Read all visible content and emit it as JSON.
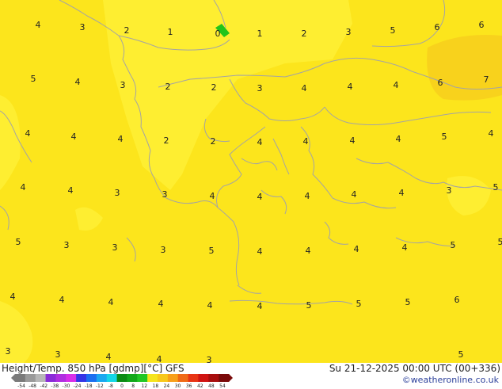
{
  "map": {
    "temperature_labels": [
      {
        "text": "4"
      },
      {
        "text": "3"
      },
      {
        "text": "2"
      },
      {
        "text": "1"
      },
      {
        "text": "0"
      },
      {
        "text": "1"
      },
      {
        "text": "2"
      },
      {
        "text": "3"
      },
      {
        "text": "5"
      },
      {
        "text": "6"
      },
      {
        "text": "6"
      },
      {
        "text": "5"
      },
      {
        "text": "4"
      },
      {
        "text": "3"
      },
      {
        "text": "2"
      },
      {
        "text": "2"
      },
      {
        "text": "3"
      },
      {
        "text": "4"
      },
      {
        "text": "4"
      },
      {
        "text": "4"
      },
      {
        "text": "6"
      },
      {
        "text": "7"
      },
      {
        "text": "4"
      },
      {
        "text": "4"
      },
      {
        "text": "4"
      },
      {
        "text": "2"
      },
      {
        "text": "2"
      },
      {
        "text": "4"
      },
      {
        "text": "4"
      },
      {
        "text": "4"
      },
      {
        "text": "4"
      },
      {
        "text": "5"
      },
      {
        "text": "4"
      },
      {
        "text": "4"
      },
      {
        "text": "4"
      },
      {
        "text": "3"
      },
      {
        "text": "3"
      },
      {
        "text": "4"
      },
      {
        "text": "4"
      },
      {
        "text": "4"
      },
      {
        "text": "4"
      },
      {
        "text": "4"
      },
      {
        "text": "3"
      },
      {
        "text": "5"
      },
      {
        "text": "5"
      },
      {
        "text": "3"
      },
      {
        "text": "3"
      },
      {
        "text": "3"
      },
      {
        "text": "5"
      },
      {
        "text": "4"
      },
      {
        "text": "4"
      },
      {
        "text": "4"
      },
      {
        "text": "4"
      },
      {
        "text": "5"
      },
      {
        "text": "5"
      },
      {
        "text": "4"
      },
      {
        "text": "4"
      },
      {
        "text": "4"
      },
      {
        "text": "4"
      },
      {
        "text": "4"
      },
      {
        "text": "4"
      },
      {
        "text": "5"
      },
      {
        "text": "5"
      },
      {
        "text": "5"
      },
      {
        "text": "6"
      },
      {
        "text": "3"
      },
      {
        "text": "3"
      },
      {
        "text": "4"
      },
      {
        "text": "4"
      },
      {
        "text": "3"
      },
      {
        "text": "5"
      }
    ],
    "colors": {
      "main": "#fce51c",
      "warm": "#f8d21c",
      "cool": "#fff23a",
      "coast": "#a4a4a4",
      "green_patch": "#22c41a"
    }
  },
  "footer": {
    "left_title": "Height/Temp. 850 hPa [gdmp][°C] GFS",
    "datetime": "Su 21-12-2025 00:00 UTC (00+336)",
    "credit": "©weatheronline.co.uk"
  },
  "colorbar": {
    "ticks": [
      "-54",
      "-48",
      "-42",
      "-38",
      "-30",
      "-24",
      "-18",
      "-12",
      "-8",
      "0",
      "8",
      "12",
      "18",
      "24",
      "30",
      "36",
      "42",
      "48",
      "54"
    ],
    "colors": [
      "#7a7a7a",
      "#9a9a9a",
      "#b7b7b7",
      "#8a2bd8",
      "#b02ee0",
      "#d82ee8",
      "#3434e6",
      "#1b6ff0",
      "#19a8f0",
      "#14d6e6",
      "#0b8b14",
      "#11a81a",
      "#21c724",
      "#f5e41c",
      "#f8c81a",
      "#f8a01a",
      "#f06a16",
      "#e83414",
      "#d01412",
      "#a80e0e",
      "#7a0a0a"
    ]
  }
}
